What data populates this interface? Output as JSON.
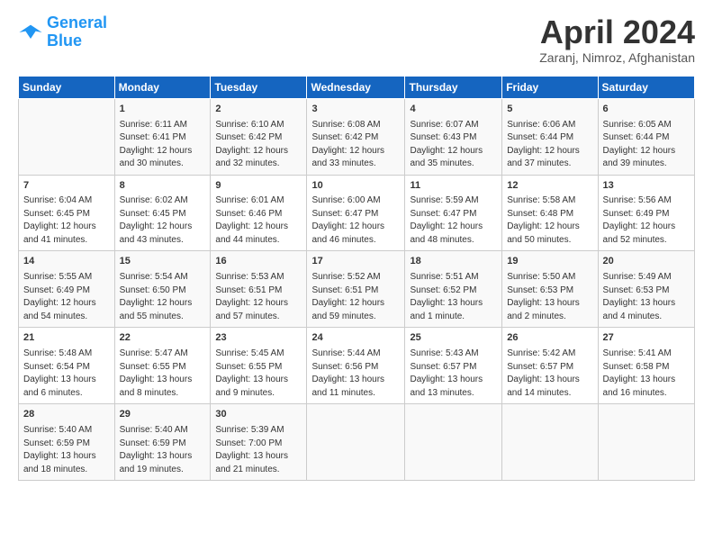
{
  "header": {
    "logo_line1": "General",
    "logo_line2": "Blue",
    "title": "April 2024",
    "subtitle": "Zaranj, Nimroz, Afghanistan"
  },
  "weekdays": [
    "Sunday",
    "Monday",
    "Tuesday",
    "Wednesday",
    "Thursday",
    "Friday",
    "Saturday"
  ],
  "weeks": [
    [
      {
        "day": "",
        "info": ""
      },
      {
        "day": "1",
        "info": "Sunrise: 6:11 AM\nSunset: 6:41 PM\nDaylight: 12 hours\nand 30 minutes."
      },
      {
        "day": "2",
        "info": "Sunrise: 6:10 AM\nSunset: 6:42 PM\nDaylight: 12 hours\nand 32 minutes."
      },
      {
        "day": "3",
        "info": "Sunrise: 6:08 AM\nSunset: 6:42 PM\nDaylight: 12 hours\nand 33 minutes."
      },
      {
        "day": "4",
        "info": "Sunrise: 6:07 AM\nSunset: 6:43 PM\nDaylight: 12 hours\nand 35 minutes."
      },
      {
        "day": "5",
        "info": "Sunrise: 6:06 AM\nSunset: 6:44 PM\nDaylight: 12 hours\nand 37 minutes."
      },
      {
        "day": "6",
        "info": "Sunrise: 6:05 AM\nSunset: 6:44 PM\nDaylight: 12 hours\nand 39 minutes."
      }
    ],
    [
      {
        "day": "7",
        "info": "Sunrise: 6:04 AM\nSunset: 6:45 PM\nDaylight: 12 hours\nand 41 minutes."
      },
      {
        "day": "8",
        "info": "Sunrise: 6:02 AM\nSunset: 6:45 PM\nDaylight: 12 hours\nand 43 minutes."
      },
      {
        "day": "9",
        "info": "Sunrise: 6:01 AM\nSunset: 6:46 PM\nDaylight: 12 hours\nand 44 minutes."
      },
      {
        "day": "10",
        "info": "Sunrise: 6:00 AM\nSunset: 6:47 PM\nDaylight: 12 hours\nand 46 minutes."
      },
      {
        "day": "11",
        "info": "Sunrise: 5:59 AM\nSunset: 6:47 PM\nDaylight: 12 hours\nand 48 minutes."
      },
      {
        "day": "12",
        "info": "Sunrise: 5:58 AM\nSunset: 6:48 PM\nDaylight: 12 hours\nand 50 minutes."
      },
      {
        "day": "13",
        "info": "Sunrise: 5:56 AM\nSunset: 6:49 PM\nDaylight: 12 hours\nand 52 minutes."
      }
    ],
    [
      {
        "day": "14",
        "info": "Sunrise: 5:55 AM\nSunset: 6:49 PM\nDaylight: 12 hours\nand 54 minutes."
      },
      {
        "day": "15",
        "info": "Sunrise: 5:54 AM\nSunset: 6:50 PM\nDaylight: 12 hours\nand 55 minutes."
      },
      {
        "day": "16",
        "info": "Sunrise: 5:53 AM\nSunset: 6:51 PM\nDaylight: 12 hours\nand 57 minutes."
      },
      {
        "day": "17",
        "info": "Sunrise: 5:52 AM\nSunset: 6:51 PM\nDaylight: 12 hours\nand 59 minutes."
      },
      {
        "day": "18",
        "info": "Sunrise: 5:51 AM\nSunset: 6:52 PM\nDaylight: 13 hours\nand 1 minute."
      },
      {
        "day": "19",
        "info": "Sunrise: 5:50 AM\nSunset: 6:53 PM\nDaylight: 13 hours\nand 2 minutes."
      },
      {
        "day": "20",
        "info": "Sunrise: 5:49 AM\nSunset: 6:53 PM\nDaylight: 13 hours\nand 4 minutes."
      }
    ],
    [
      {
        "day": "21",
        "info": "Sunrise: 5:48 AM\nSunset: 6:54 PM\nDaylight: 13 hours\nand 6 minutes."
      },
      {
        "day": "22",
        "info": "Sunrise: 5:47 AM\nSunset: 6:55 PM\nDaylight: 13 hours\nand 8 minutes."
      },
      {
        "day": "23",
        "info": "Sunrise: 5:45 AM\nSunset: 6:55 PM\nDaylight: 13 hours\nand 9 minutes."
      },
      {
        "day": "24",
        "info": "Sunrise: 5:44 AM\nSunset: 6:56 PM\nDaylight: 13 hours\nand 11 minutes."
      },
      {
        "day": "25",
        "info": "Sunrise: 5:43 AM\nSunset: 6:57 PM\nDaylight: 13 hours\nand 13 minutes."
      },
      {
        "day": "26",
        "info": "Sunrise: 5:42 AM\nSunset: 6:57 PM\nDaylight: 13 hours\nand 14 minutes."
      },
      {
        "day": "27",
        "info": "Sunrise: 5:41 AM\nSunset: 6:58 PM\nDaylight: 13 hours\nand 16 minutes."
      }
    ],
    [
      {
        "day": "28",
        "info": "Sunrise: 5:40 AM\nSunset: 6:59 PM\nDaylight: 13 hours\nand 18 minutes."
      },
      {
        "day": "29",
        "info": "Sunrise: 5:40 AM\nSunset: 6:59 PM\nDaylight: 13 hours\nand 19 minutes."
      },
      {
        "day": "30",
        "info": "Sunrise: 5:39 AM\nSunset: 7:00 PM\nDaylight: 13 hours\nand 21 minutes."
      },
      {
        "day": "",
        "info": ""
      },
      {
        "day": "",
        "info": ""
      },
      {
        "day": "",
        "info": ""
      },
      {
        "day": "",
        "info": ""
      }
    ]
  ]
}
